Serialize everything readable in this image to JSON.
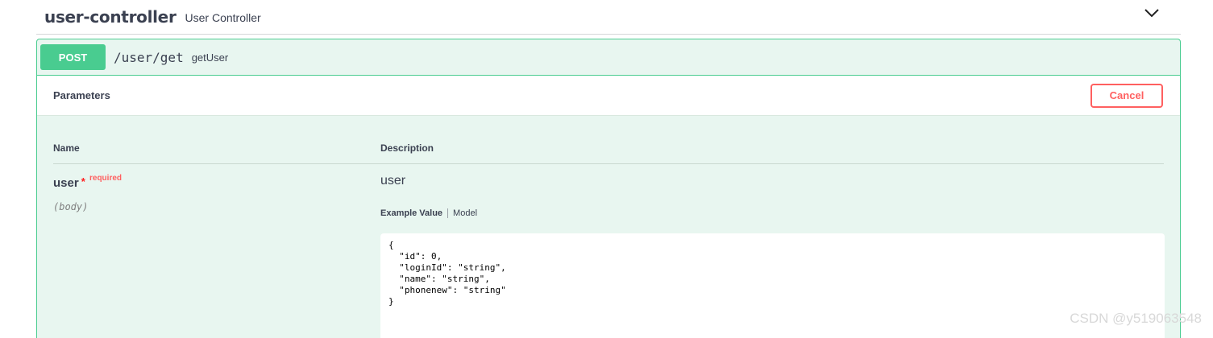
{
  "tag": {
    "title": "user-controller",
    "description": "User Controller",
    "toggle_icon": "chevron-down-icon"
  },
  "operation": {
    "method": "POST",
    "path": "/user/get",
    "summary": "getUser"
  },
  "parameters_section": {
    "title": "Parameters",
    "cancel_label": "Cancel"
  },
  "table": {
    "col_name": "Name",
    "col_description": "Description"
  },
  "param": {
    "name": "user",
    "required_star": "*",
    "required_label": "required",
    "in": "(body)",
    "description": "user",
    "tab_example": "Example Value",
    "tab_model": "Model",
    "example_value": "{\n  \"id\": 0,\n  \"loginId\": \"string\",\n  \"name\": \"string\",\n  \"phonenew\": \"string\"\n}"
  },
  "watermark": "CSDN @y519063548",
  "colors": {
    "post_green": "#49cc90",
    "post_bg": "#e8f6f0",
    "cancel_red": "#ff6060",
    "text": "#3b4151"
  }
}
